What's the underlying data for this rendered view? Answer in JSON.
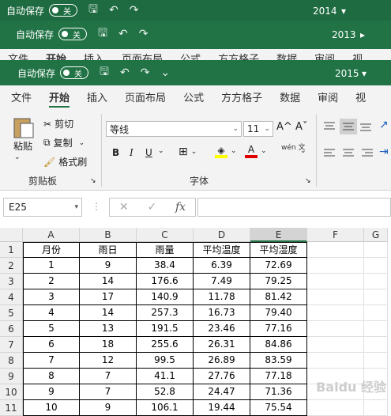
{
  "windows": {
    "w2014": {
      "autosave": "自动保存",
      "toggle": "关",
      "version": "2014",
      "version_arrow": "▾"
    },
    "w2013": {
      "autosave": "自动保存",
      "toggle": "关",
      "version": "2013",
      "version_arrow": "▸"
    },
    "w2015": {
      "autosave": "自动保存",
      "toggle": "关",
      "version": "2015",
      "version_arrow": "▾"
    }
  },
  "menu_back": [
    "文件",
    "开始",
    "插入",
    "页面布局",
    "公式",
    "方方格子",
    "数据",
    "审阅",
    "视"
  ],
  "menu": [
    "文件",
    "开始",
    "插入",
    "页面布局",
    "公式",
    "方方格子",
    "数据",
    "审阅",
    "视"
  ],
  "ribbon": {
    "paste": "粘贴",
    "cut": "剪切",
    "copy": "复制",
    "format_painter": "格式刷",
    "clipboard": "剪贴板",
    "font_name": "等线",
    "font_size": "11",
    "font_group": "字体",
    "wen": "wén 文",
    "bold": "B",
    "italic": "I",
    "underline": "U",
    "grow": "A^",
    "shrink": "Aˇ",
    "font_color": "A",
    "highlight": "◈"
  },
  "formula_bar": {
    "name_box": "E25",
    "cancel": "✕",
    "confirm": "✓",
    "fx": "fx",
    "value": ""
  },
  "sheet": {
    "columns": [
      "A",
      "B",
      "C",
      "D",
      "E",
      "F",
      "G"
    ],
    "rows": [
      "1",
      "2",
      "3",
      "4",
      "5",
      "6",
      "7",
      "8",
      "9",
      "10",
      "11"
    ],
    "data": [
      [
        "月份",
        "雨日",
        "雨量",
        "平均温度",
        "平均湿度"
      ],
      [
        "1",
        "9",
        "38.4",
        "6.39",
        "72.69"
      ],
      [
        "2",
        "14",
        "176.6",
        "7.49",
        "79.25"
      ],
      [
        "3",
        "17",
        "140.9",
        "11.78",
        "81.42"
      ],
      [
        "4",
        "14",
        "257.3",
        "16.73",
        "79.40"
      ],
      [
        "5",
        "13",
        "191.5",
        "23.46",
        "77.16"
      ],
      [
        "6",
        "18",
        "255.6",
        "26.31",
        "84.86"
      ],
      [
        "7",
        "12",
        "99.5",
        "26.89",
        "83.59"
      ],
      [
        "8",
        "7",
        "41.1",
        "27.76",
        "77.18"
      ],
      [
        "9",
        "7",
        "52.8",
        "24.47",
        "71.36"
      ],
      [
        "10",
        "9",
        "106.1",
        "19.44",
        "75.54"
      ]
    ]
  },
  "accent": "#217346"
}
